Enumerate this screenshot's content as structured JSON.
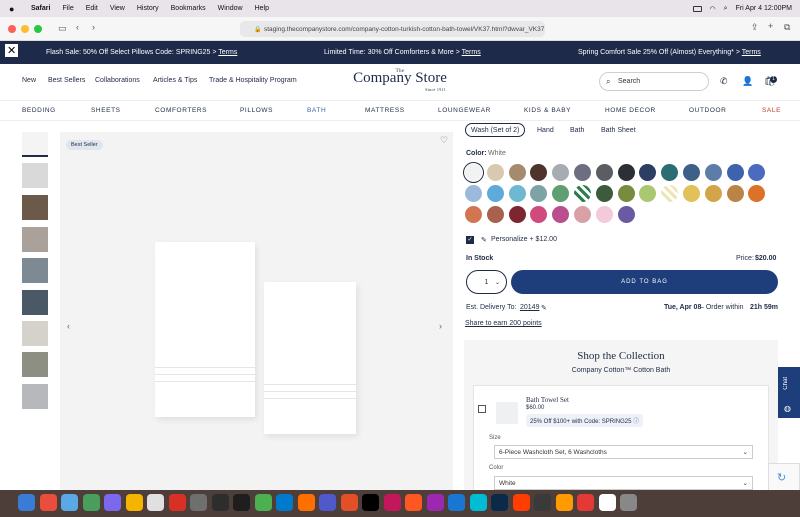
{
  "menubar": {
    "app": "Safari",
    "items": [
      "File",
      "Edit",
      "View",
      "History",
      "Bookmarks",
      "Window",
      "Help"
    ],
    "clock": "Fri Apr 4  12:00PM"
  },
  "browser": {
    "url": "staging.thecompanystore.com/company-cotton-turkish-cotton-bath-towel/VK37.html?dwvar_VK37"
  },
  "promo": {
    "p1_text": "Flash Sale: 50% Off Select Pillows Code: SPRING25 > ",
    "p1_link": "Terms",
    "p2_text": "Limited Time: 30% Off Comforters & More > ",
    "p2_link": "Terms",
    "p3_text": "Spring Comfort Sale 25% Off (Almost) Everything* > ",
    "p3_link": "Terms"
  },
  "header": {
    "nav": [
      "New",
      "Best Sellers",
      "Collaborations",
      "Articles & Tips",
      "Trade & Hospitality Program"
    ],
    "logo_small": "The",
    "logo_main": "Company Store",
    "logo_since": "Since 1911",
    "search_placeholder": "Search",
    "cart_count": "1"
  },
  "categories": [
    "BEDDING",
    "SHEETS",
    "COMFORTERS",
    "PILLOWS",
    "BATH",
    "MATTRESS",
    "LOUNGEWEAR",
    "KIDS & BABY",
    "HOME DECOR",
    "OUTDOOR",
    "SALE"
  ],
  "gallery": {
    "badge": "Best Seller"
  },
  "product": {
    "options": [
      "Wash (Set of 2)",
      "Hand",
      "Bath",
      "Bath Sheet"
    ],
    "color_label": "Color:",
    "color_value": "White",
    "swatches": [
      "#f2f2f2",
      "#d8c9b0",
      "#a58a6e",
      "#4e342b",
      "#a7acb3",
      "#6d6f80",
      "#5a5d62",
      "#2c2f36",
      "#2b3e63",
      "#2a6d73",
      "#3e5f88",
      "#5b7da8",
      "#3d63ad",
      "#4b6bc1",
      "#9cb9dc",
      "#5eaadb",
      "#6fb8d1",
      "#7da3a6",
      "#5f9f70",
      "#2c7c4e",
      "#3e5a3c",
      "#788c3f",
      "#a9c86f",
      "#ece6b4",
      "#e1c15a",
      "#d2a54a",
      "#bb8446",
      "#dc7127",
      "#d47551",
      "#a7614c",
      "#7d2530",
      "#d04a7e",
      "#ba4e8e",
      "#d9a0a8",
      "#f2cad9",
      "#6a5aa3"
    ],
    "personalize": "Personalize + $12.00",
    "stock": "In Stock",
    "price_label": "Price:",
    "price": "$20.00",
    "qty": "1",
    "add_to_bag": "ADD TO BAG",
    "delivery_label": "Est. Delivery To:",
    "zip": "20149",
    "delivery_date": "Tue, Apr 08",
    "delivery_rest": " – Order within ",
    "delivery_time": "21h 59m",
    "share": "Share to earn 200 points"
  },
  "collection": {
    "title": "Shop the Collection",
    "subtitle": "Company Cotton™ Cotton Bath",
    "item_name": "Bath Towel Set",
    "item_price": "$60.00",
    "promo": "25% Off $100+ with Code: SPRING25",
    "size_label": "Size",
    "size_value": "6-Piece Washcloth Set, 6 Washcloths",
    "color_label": "Color",
    "color_value": "White"
  },
  "chat": "Chat"
}
